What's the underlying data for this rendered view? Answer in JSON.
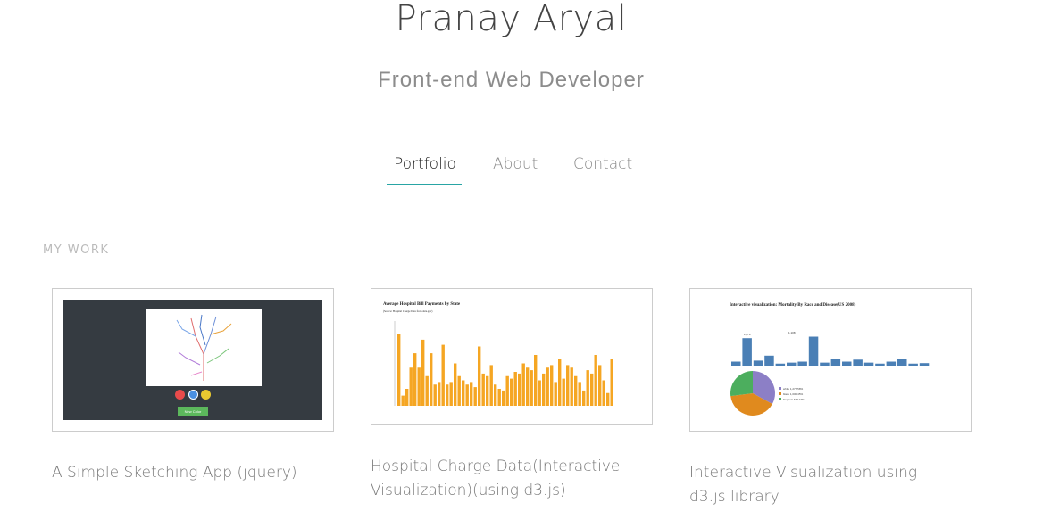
{
  "header": {
    "name": "Pranay Aryal",
    "role": "Front-end Web Developer"
  },
  "nav": {
    "items": [
      {
        "label": "Portfolio",
        "active": true
      },
      {
        "label": "About",
        "active": false
      },
      {
        "label": "Contact",
        "active": false
      }
    ]
  },
  "work": {
    "section_label": "MY WORK",
    "projects": [
      {
        "title": "A Simple Sketching App (jquery)",
        "thumb": {
          "button_label": "New Color",
          "colors": [
            "#e94b4b",
            "#4a90e2",
            "#e8c830"
          ]
        }
      },
      {
        "title": "Hospital Charge Data(Interactive Visualization)(using d3.js)",
        "thumb": {
          "chart_title": "Average Hospital Bill Payments by State",
          "chart_subtitle": "(Source: Hospital Charge Data from data.gov)",
          "bar_color": "#f5a623"
        }
      },
      {
        "title": "Interactive Visualization using d3.js library",
        "thumb": {
          "chart_title": "Interactive visualization: Mortality By Race and Disease(US 2008)",
          "bar_color": "#4a7fb5",
          "top_labels": [
            "1,073",
            "1,108"
          ],
          "pie_legend": [
            {
              "label": "white",
              "value": "1,277",
              "pct": "58%",
              "color": "#8c7fc6"
            },
            {
              "label": "black",
              "value": "1,000",
              "pct": "45%",
              "color": "#e08a1e"
            },
            {
              "label": "hispanic",
              "value": "678",
              "pct": "27%",
              "color": "#4cae5e"
            }
          ]
        }
      }
    ]
  },
  "accent": "#29a5a5"
}
